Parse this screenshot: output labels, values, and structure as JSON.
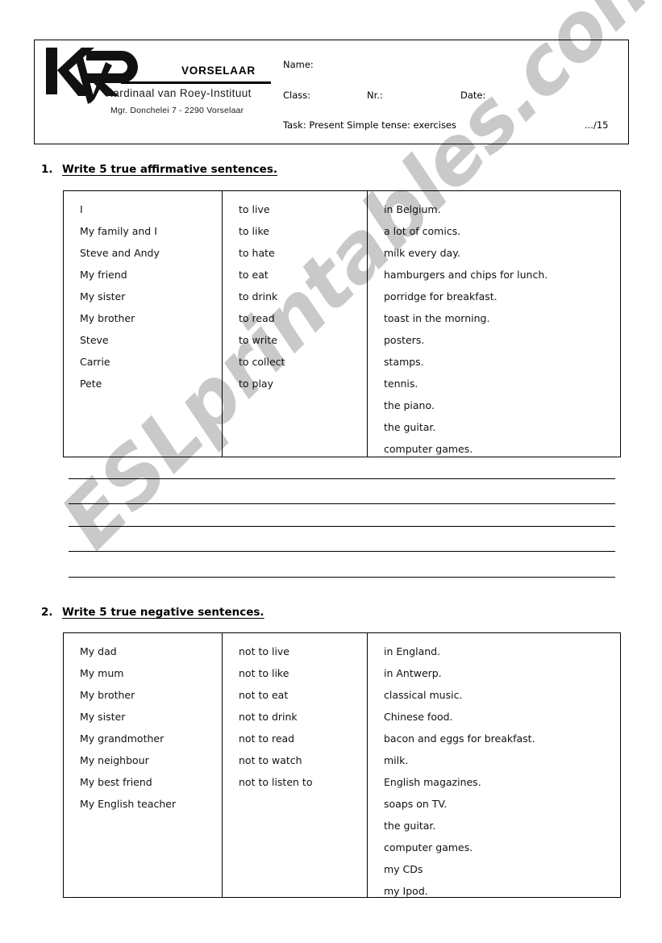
{
  "document": {
    "type": "worksheet",
    "watermark": "ESLprintables.com"
  },
  "header": {
    "logo": {
      "monogram": "KvR",
      "vorselaar": "VORSELAAR",
      "institute": "Kardinaal van Roey-Instituut",
      "address": "Mgr. Donchelei 7 - 2290 Vorselaar"
    },
    "fields": {
      "name_label": "Name:",
      "class_label": "Class:",
      "nr_label": "Nr.:",
      "date_label": "Date:",
      "task_label": "Task: Present Simple tense: exercises",
      "score_label": ".../15"
    }
  },
  "exercises": [
    {
      "number": "1.",
      "title": "Write 5 true affirmative sentences.",
      "table": {
        "subjects": [
          "I",
          "My family and I",
          "Steve and Andy",
          "My friend",
          "My sister",
          "My brother",
          "Steve",
          "Carrie",
          "Pete"
        ],
        "verbs": [
          "to live",
          "to like",
          "to hate",
          "to eat",
          "to drink",
          "to read",
          "to write",
          "to collect",
          "to play"
        ],
        "objects": [
          "in Belgium.",
          "a lot of comics.",
          "milk every day.",
          "hamburgers and chips for lunch.",
          "porridge for breakfast.",
          "toast in the morning.",
          "posters.",
          "stamps.",
          "tennis.",
          "the piano.",
          "the guitar.",
          "computer games."
        ]
      },
      "answer_lines": 5
    },
    {
      "number": "2.",
      "title": "Write 5 true negative sentences.",
      "table": {
        "subjects": [
          "My dad",
          "My mum",
          "My brother",
          "My sister",
          "My grandmother",
          "My neighbour",
          "My best friend",
          "My English teacher"
        ],
        "verbs": [
          "not to live",
          "not to like",
          "not to eat",
          "not to drink",
          "not to read",
          "not to watch",
          "not to listen to"
        ],
        "objects": [
          "in England.",
          "in Antwerp.",
          "classical music.",
          "Chinese food.",
          "bacon and eggs for breakfast.",
          "milk.",
          "English magazines.",
          "soaps on TV.",
          "the guitar.",
          "computer games.",
          "my CDs",
          "my Ipod."
        ]
      },
      "answer_lines": 0
    }
  ]
}
